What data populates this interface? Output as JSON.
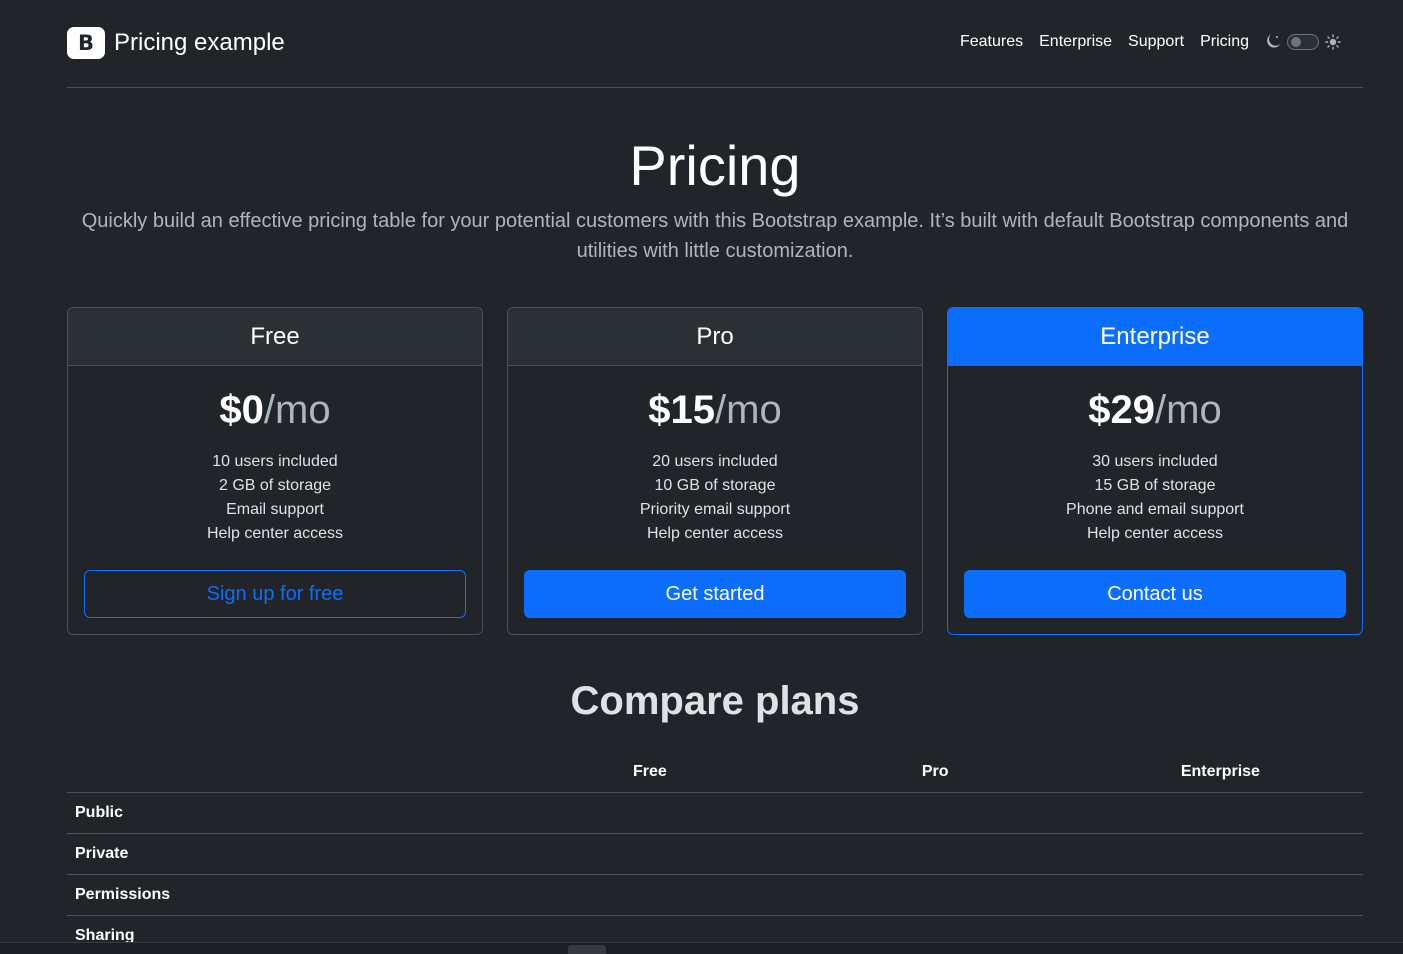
{
  "header": {
    "brand_letter": "B",
    "brand_title": "Pricing example",
    "nav": [
      "Features",
      "Enterprise",
      "Support",
      "Pricing"
    ],
    "theme_icons": [
      "moon-icon",
      "sun-icon"
    ]
  },
  "hero": {
    "title": "Pricing",
    "lead": "Quickly build an effective pricing table for your potential customers with this Bootstrap example. It’s built with default Bootstrap components and utilities with little customization."
  },
  "plans": [
    {
      "name": "Free",
      "price": "$0",
      "period": "/mo",
      "features": [
        "10 users included",
        "2 GB of storage",
        "Email support",
        "Help center access"
      ],
      "button": "Sign up for free"
    },
    {
      "name": "Pro",
      "price": "$15",
      "period": "/mo",
      "features": [
        "20 users included",
        "10 GB of storage",
        "Priority email support",
        "Help center access"
      ],
      "button": "Get started"
    },
    {
      "name": "Enterprise",
      "price": "$29",
      "period": "/mo",
      "features": [
        "30 users included",
        "15 GB of storage",
        "Phone and email support",
        "Help center access"
      ],
      "button": "Contact us"
    }
  ],
  "compare": {
    "title": "Compare plans",
    "columns": [
      "Free",
      "Pro",
      "Enterprise"
    ],
    "rows": [
      "Public",
      "Private",
      "Permissions",
      "Sharing"
    ]
  },
  "colors": {
    "background": "#212529",
    "accent": "#0d6efd",
    "border": "#495057"
  }
}
